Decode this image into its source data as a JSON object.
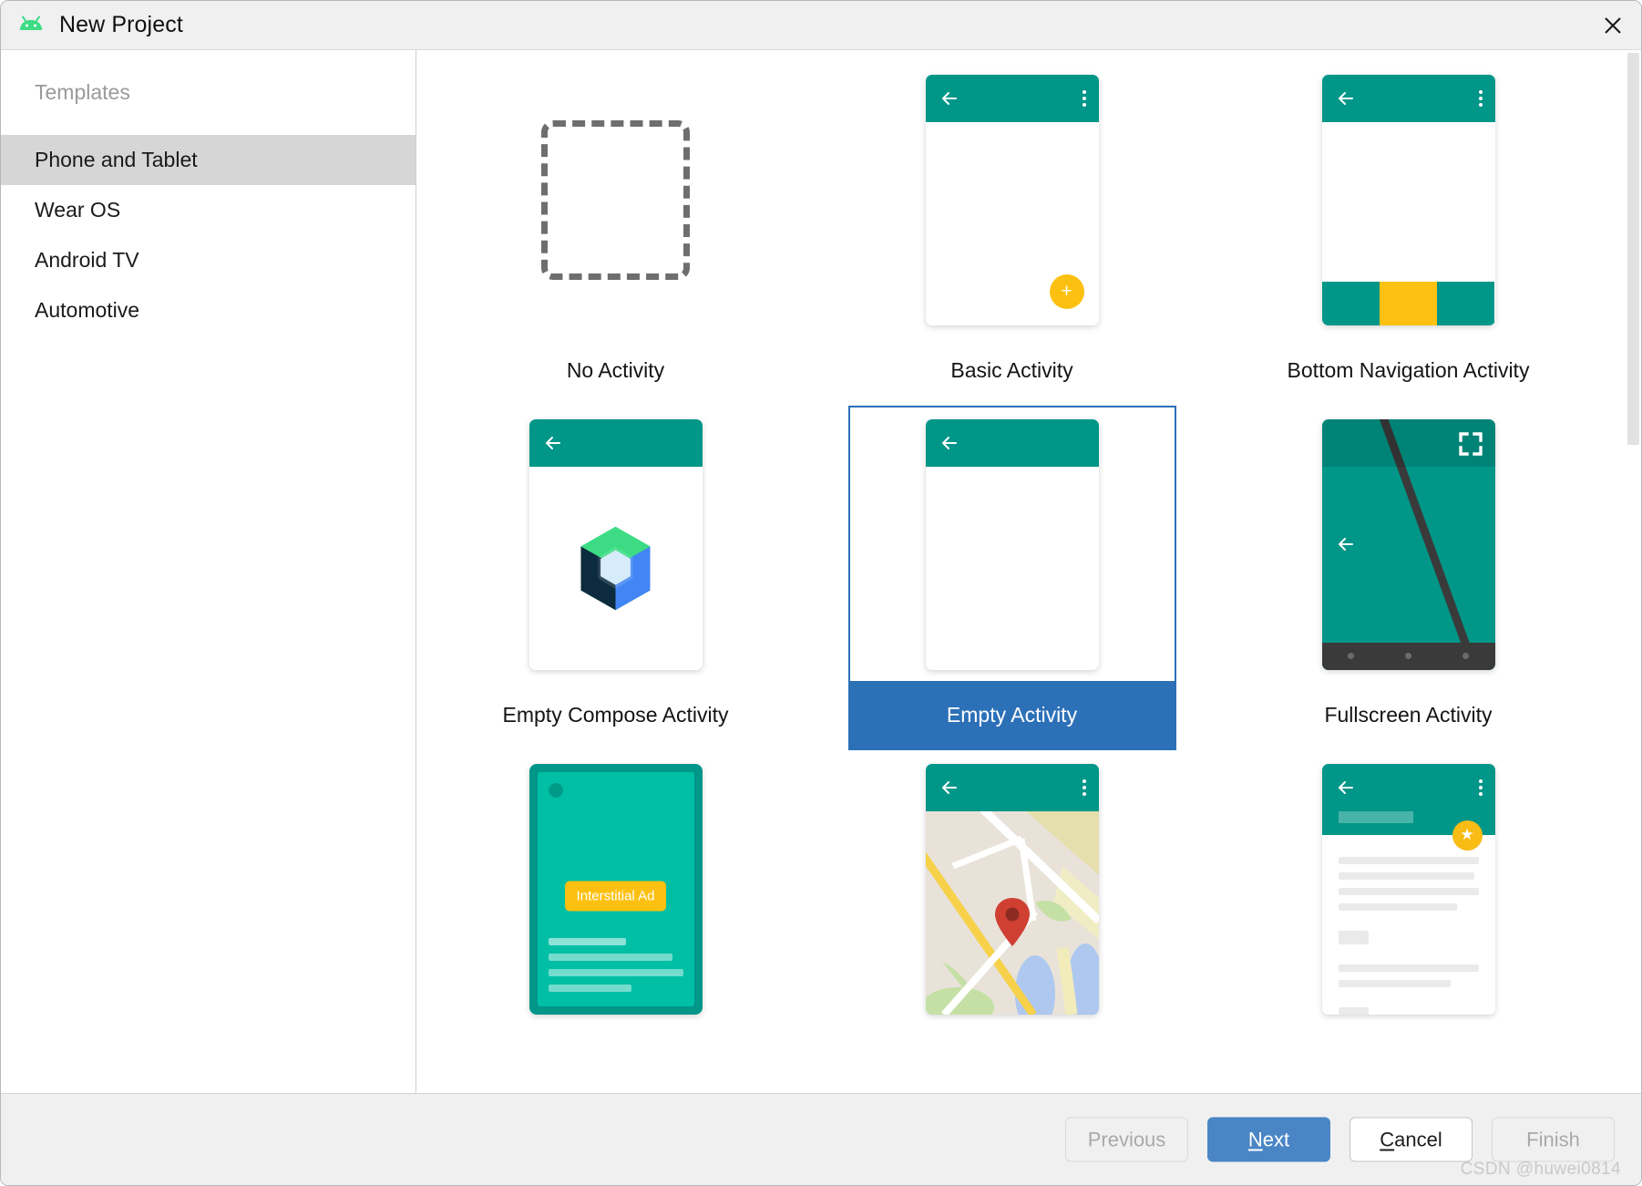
{
  "window": {
    "title": "New Project",
    "app_icon": "android-icon",
    "close_icon": "close-icon"
  },
  "sidebar": {
    "header": "Templates",
    "items": [
      {
        "label": "Phone and Tablet",
        "selected": true
      },
      {
        "label": "Wear OS",
        "selected": false
      },
      {
        "label": "Android TV",
        "selected": false
      },
      {
        "label": "Automotive",
        "selected": false
      }
    ]
  },
  "templates": {
    "selected": "Empty Activity",
    "items": [
      {
        "label": "No Activity",
        "thumb": "dashed-box"
      },
      {
        "label": "Basic Activity",
        "thumb": "basic-activity"
      },
      {
        "label": "Bottom Navigation Activity",
        "thumb": "bottom-navigation"
      },
      {
        "label": "Empty Compose Activity",
        "thumb": "compose-logo"
      },
      {
        "label": "Empty Activity",
        "thumb": "empty-activity"
      },
      {
        "label": "Fullscreen Activity",
        "thumb": "fullscreen-activity"
      },
      {
        "label": "",
        "thumb": "interstitial-ad"
      },
      {
        "label": "",
        "thumb": "google-maps"
      },
      {
        "label": "",
        "thumb": "scrolling-activity"
      }
    ],
    "ad_button_label": "Interstitial Ad"
  },
  "footer": {
    "previous": "Previous",
    "next": "Next",
    "next_mnemonic": "N",
    "next_rest": "ext",
    "cancel_mnemonic": "C",
    "cancel_rest": "ancel",
    "finish": "Finish"
  },
  "watermark": "CSDN @huwei0814",
  "colors": {
    "teal": "#009688",
    "teal_light": "#00bfa5",
    "yellow": "#fcc010",
    "accent_blue": "#2c70b8",
    "primary_button": "#4a86c5",
    "map_land": "#e8e2d9",
    "map_pin": "#d1392c",
    "dark_bar": "#3a3a3a"
  }
}
